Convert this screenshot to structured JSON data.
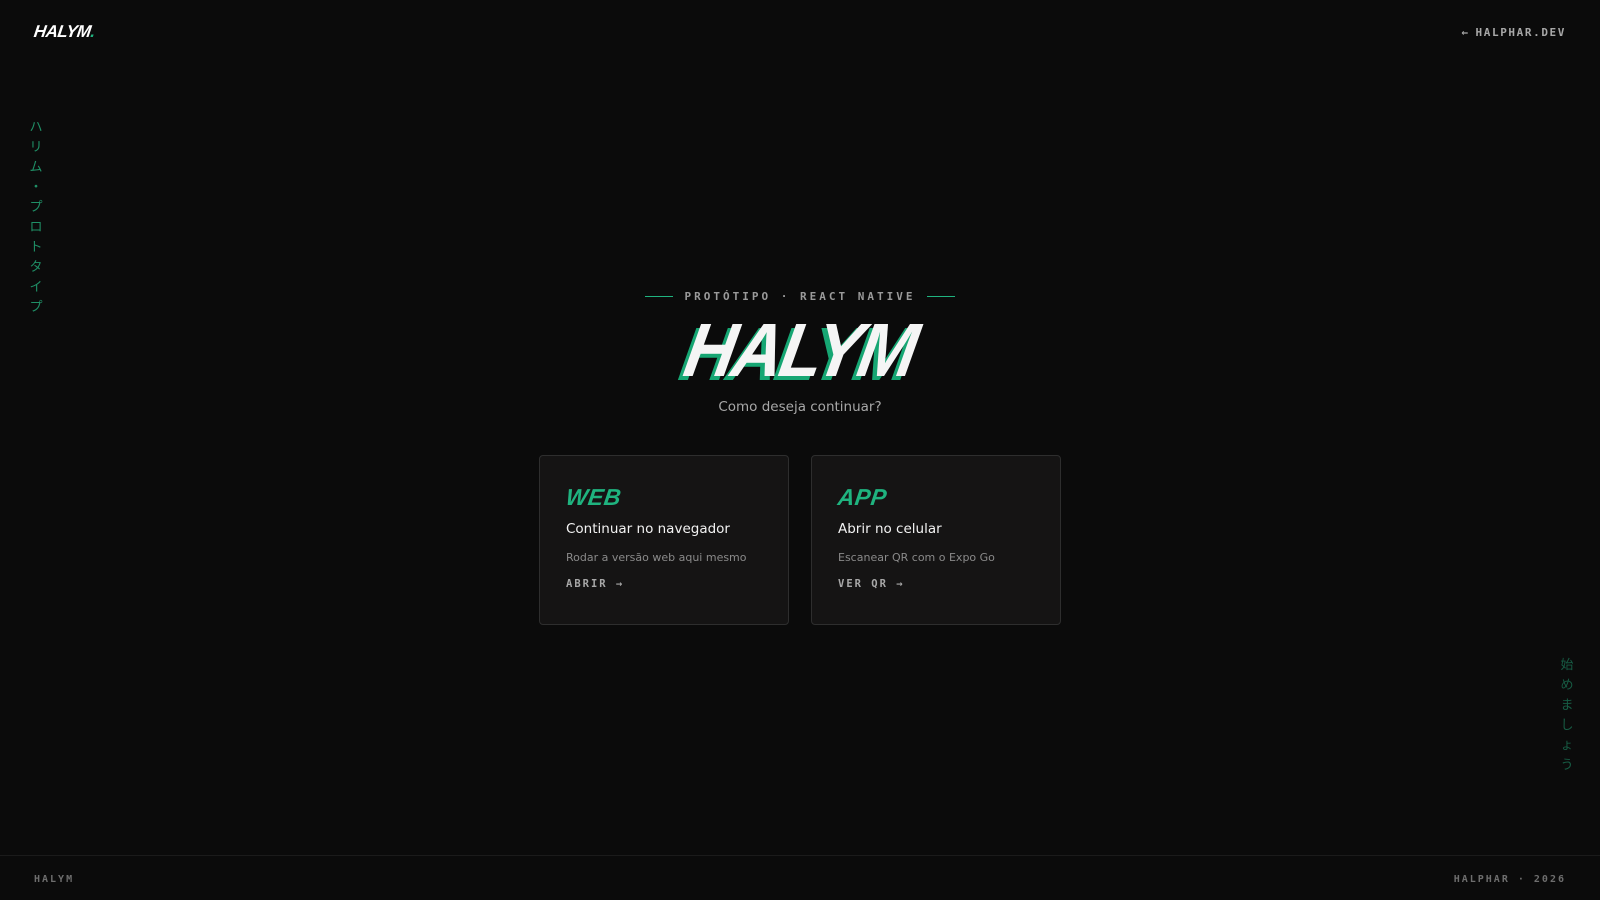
{
  "header": {
    "logo": "HALYM",
    "logo_dot": ".",
    "back_arrow": "←",
    "back_label": "HALPHAR.DEV"
  },
  "side_left": [
    "ハ",
    "リ",
    "ム",
    "・",
    "プ",
    "ロ",
    "ト",
    "タ",
    "イ",
    "プ"
  ],
  "side_right": [
    "始",
    "め",
    "ま",
    "し",
    "ょ",
    "う"
  ],
  "hero": {
    "eyebrow": "PROTÓTIPO · REACT NATIVE",
    "title": "HALYM",
    "subtitle": "Como deseja continuar?"
  },
  "cards": [
    {
      "tag": "WEB",
      "title": "Continuar no navegador",
      "desc": "Rodar a versão web aqui mesmo",
      "cta": "ABRIR →"
    },
    {
      "tag": "APP",
      "title": "Abrir no celular",
      "desc": "Escanear QR com o Expo Go",
      "cta": "VER QR →"
    }
  ],
  "footer": {
    "left": "HALYM",
    "right": "HALPHAR · 2026"
  },
  "colors": {
    "background": "#0b0b0b",
    "accent": "#1fb37f",
    "card": "#151414"
  }
}
